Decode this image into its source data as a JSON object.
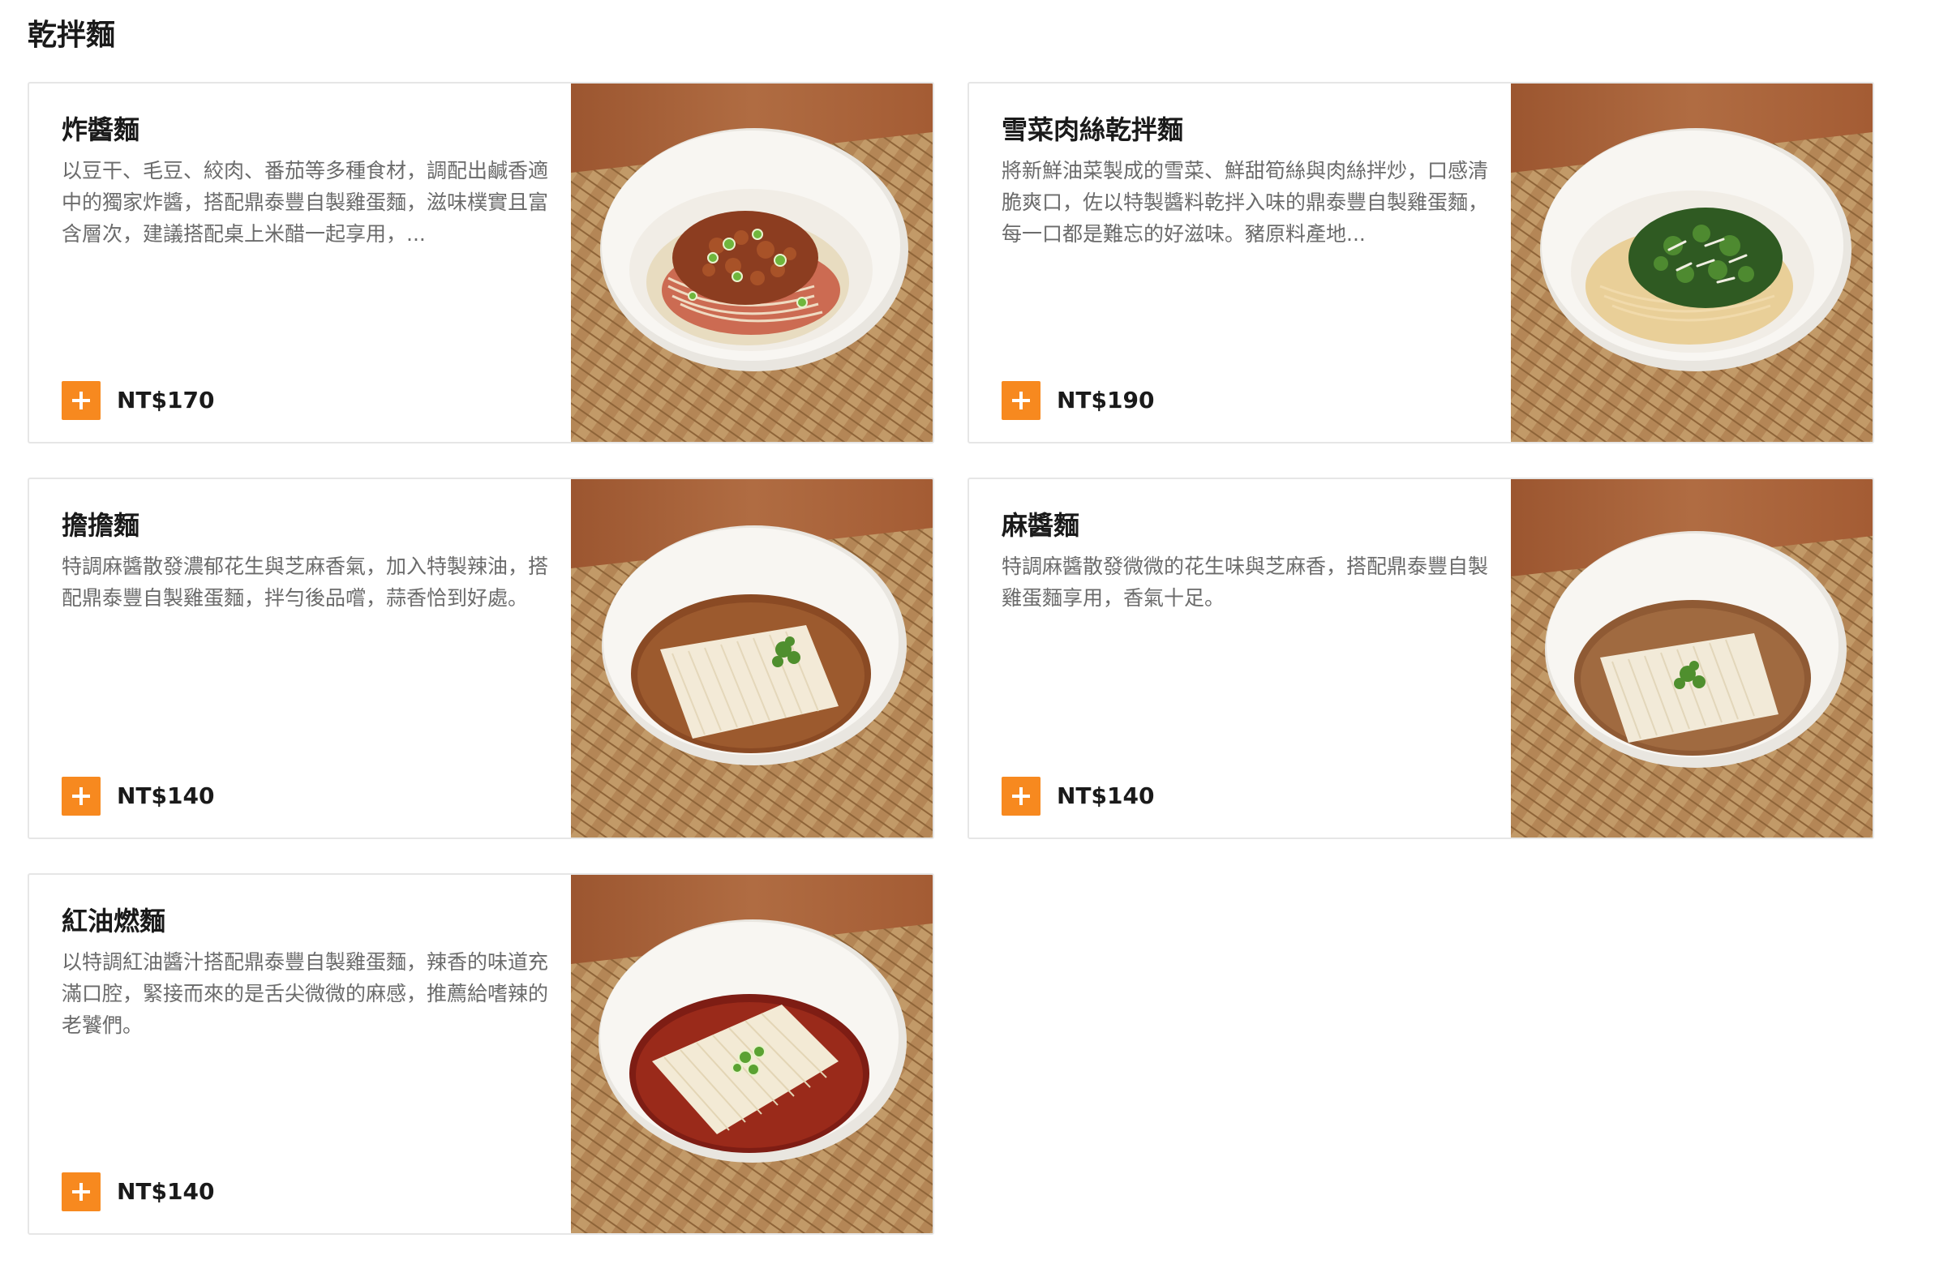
{
  "section": {
    "title": "乾拌麵"
  },
  "items": [
    {
      "name": "炸醬麵",
      "description": "以豆干、毛豆、絞肉、番茄等多種食材，調配出鹹香適中的獨家炸醬，搭配鼎泰豐自製雞蛋麵，滋味樸實且富含層次，建議搭配桌上米醋一起享用，...",
      "price": "NT$170",
      "image": "noodle-bowl-minced-pork-sauce"
    },
    {
      "name": "雪菜肉絲乾拌麵",
      "description": "將新鮮油菜製成的雪菜、鮮甜筍絲與肉絲拌炒，口感清脆爽口，佐以特製醬料乾拌入味的鼎泰豐自製雞蛋麵，每一口都是難忘的好滋味。豬原料產地...",
      "price": "NT$190",
      "image": "noodle-bowl-pickled-greens"
    },
    {
      "name": "擔擔麵",
      "description": "特調麻醬散發濃郁花生與芝麻香氣，加入特製辣油，搭配鼎泰豐自製雞蛋麵，拌勻後品嚐，蒜香恰到好處。",
      "price": "NT$140",
      "image": "noodle-bowl-dandan"
    },
    {
      "name": "麻醬麵",
      "description": "特調麻醬散發微微的花生味與芝麻香，搭配鼎泰豐自製雞蛋麵享用，香氣十足。",
      "price": "NT$140",
      "image": "noodle-bowl-sesame-sauce"
    },
    {
      "name": "紅油燃麵",
      "description": "以特調紅油醬汁搭配鼎泰豐自製雞蛋麵，辣香的味道充滿口腔，緊接而來的是舌尖微微的麻感，推薦給嗜辣的老饕們。",
      "price": "NT$140",
      "image": "noodle-bowl-red-chili-oil"
    }
  ],
  "colors": {
    "accent": "#f7891f",
    "card_border": "#e6e6e6",
    "description_text": "#6b6b6b",
    "wood_table": "#a8623a",
    "woven_mat": "#b8895a",
    "bowl": "#f7f5f1",
    "noodle": "#efe3c8"
  }
}
